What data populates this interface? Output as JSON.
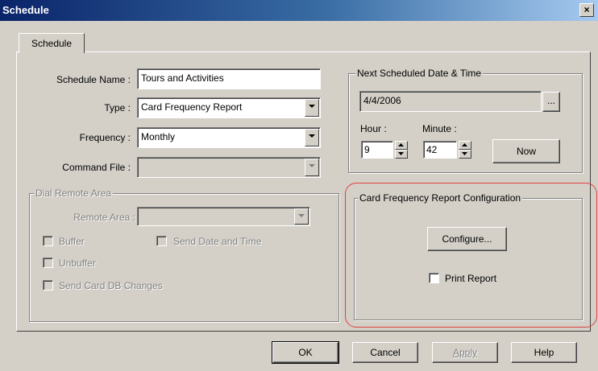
{
  "window": {
    "title": "Schedule",
    "close_symbol": "×"
  },
  "tab": {
    "label": "Schedule"
  },
  "form": {
    "schedule_name_label": "Schedule Name :",
    "schedule_name_value": "Tours and Activities",
    "type_label": "Type :",
    "type_value": "Card Frequency Report",
    "frequency_label": "Frequency :",
    "frequency_value": "Monthly",
    "command_file_label": "Command File :",
    "command_file_value": ""
  },
  "dial_remote": {
    "legend": "Dial Remote Area",
    "remote_area_label": "Remote Area :",
    "remote_area_value": "",
    "buffer_label": "Buffer",
    "send_date_time_label": "Send Date and Time",
    "unbuffer_label": "Unbuffer",
    "send_card_db_label": "Send Card DB Changes"
  },
  "next_scheduled": {
    "legend": "Next Scheduled Date & Time",
    "date_value": "4/4/2006",
    "browse_label": "...",
    "hour_label": "Hour :",
    "hour_value": "9",
    "minute_label": "Minute :",
    "minute_value": "42",
    "now_label": "Now"
  },
  "report_config": {
    "legend": "Card Frequency Report Configuration",
    "configure_label": "Configure...",
    "print_report_label": "Print Report",
    "print_report_checked": false,
    "highlight_color": "#e04040"
  },
  "buttons": {
    "ok": "OK",
    "cancel": "Cancel",
    "apply": "Apply",
    "help": "Help"
  }
}
